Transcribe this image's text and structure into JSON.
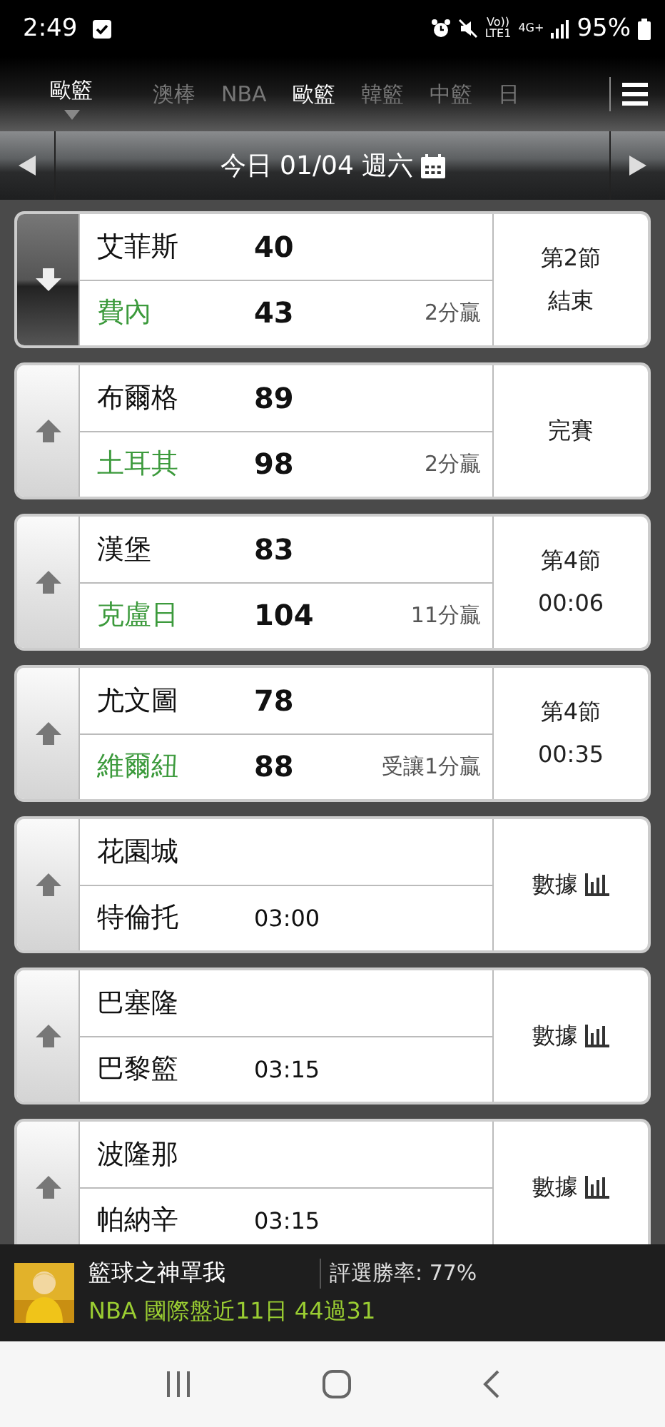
{
  "status_bar": {
    "time": "2:49",
    "volte": "Vo))",
    "lte": "LTE1",
    "network": "4G+",
    "battery": "95%"
  },
  "league_tabs": {
    "current": "歐籃",
    "items": [
      {
        "label": "澳棒",
        "selected": false
      },
      {
        "label": "NBA",
        "selected": false
      },
      {
        "label": "歐籃",
        "selected": true
      },
      {
        "label": "韓籃",
        "selected": false
      },
      {
        "label": "中籃",
        "selected": false
      },
      {
        "label": "日",
        "selected": false
      }
    ]
  },
  "date_bar": {
    "label": "今日 01/04 週六"
  },
  "games": [
    {
      "kind": "result",
      "expanded": true,
      "teams": [
        {
          "name": "艾菲斯",
          "score": "40",
          "winner": false
        },
        {
          "name": "費內",
          "score": "43",
          "winner": true,
          "note": "2分贏"
        }
      ],
      "status": [
        "第2節",
        "結束"
      ]
    },
    {
      "kind": "result",
      "expanded": false,
      "teams": [
        {
          "name": "布爾格",
          "score": "89",
          "winner": false
        },
        {
          "name": "土耳其",
          "score": "98",
          "winner": true,
          "note": "2分贏"
        }
      ],
      "status": [
        "完賽"
      ]
    },
    {
      "kind": "result",
      "expanded": false,
      "teams": [
        {
          "name": "漢堡",
          "score": "83",
          "winner": false
        },
        {
          "name": "克盧日",
          "score": "104",
          "winner": true,
          "note": "11分贏"
        }
      ],
      "status": [
        "第4節",
        "00:06"
      ]
    },
    {
      "kind": "result",
      "expanded": false,
      "teams": [
        {
          "name": "尤文圖",
          "score": "78",
          "winner": false
        },
        {
          "name": "維爾紐",
          "score": "88",
          "winner": true,
          "note": "受讓1分贏"
        }
      ],
      "status": [
        "第4節",
        "00:35"
      ]
    },
    {
      "kind": "upcoming",
      "expanded": false,
      "teams": [
        {
          "name": "花園城"
        },
        {
          "name": "特倫托",
          "time": "03:00"
        }
      ],
      "status": [
        "數據"
      ]
    },
    {
      "kind": "upcoming",
      "expanded": false,
      "teams": [
        {
          "name": "巴塞隆"
        },
        {
          "name": "巴黎籃",
          "time": "03:15"
        }
      ],
      "status": [
        "數據"
      ]
    },
    {
      "kind": "upcoming",
      "expanded": false,
      "teams": [
        {
          "name": "波隆那"
        },
        {
          "name": "帕納辛",
          "time": "03:15"
        }
      ],
      "status": [
        "數據"
      ]
    }
  ],
  "banner": {
    "name": "籃球之神罩我",
    "win_rate": "評選勝率: 77%",
    "record": "NBA 國際盤近11日 44過31"
  }
}
